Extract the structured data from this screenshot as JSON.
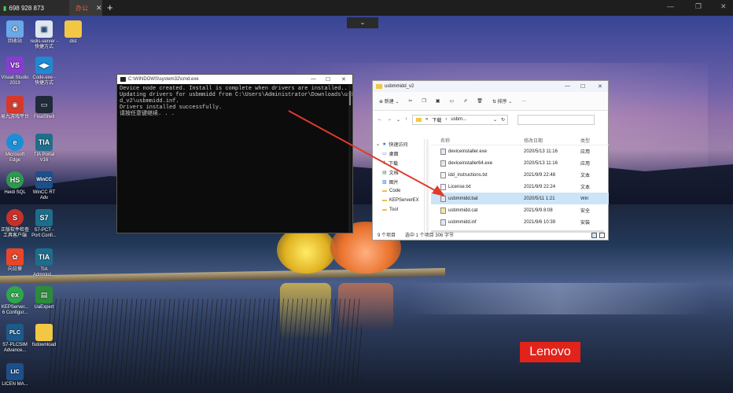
{
  "remote_bar": {
    "tab1_title": "698 928 873",
    "tab2_title": "办公",
    "tab2_close": "✕",
    "new_tab": "+",
    "dropdown": "⌄",
    "min": "—",
    "restore": "❐",
    "close": "✕"
  },
  "desktop_icons": [
    {
      "label": "回收站",
      "color": "#6aa8e8",
      "glyph": "♻"
    },
    {
      "label": "redis-server - 快捷方式",
      "color": "#dfe6f0",
      "glyph": "▣"
    },
    {
      "label": "dist",
      "color": "#f2c744",
      "glyph": ""
    },
    {
      "label": "Visual Studio 2019",
      "color": "#8a3bd1",
      "glyph": "VS"
    },
    {
      "label": "Code.exe - 快捷方式",
      "color": "#1f8ad2",
      "glyph": "◀▶"
    },
    {
      "label": "易九游戏平台",
      "color": "#d8382a",
      "glyph": "◉"
    },
    {
      "label": "FinalShell",
      "color": "#202a3a",
      "glyph": "▭"
    },
    {
      "label": "Microsoft Edge",
      "color": "#1a8fd8",
      "glyph": "e"
    },
    {
      "label": "TIA Portal V16",
      "color": "#1f6f8c",
      "glyph": "TIA"
    },
    {
      "label": "Heidi SQL",
      "color": "#2d9b4d",
      "glyph": "HS"
    },
    {
      "label": "WinCC RT Adv",
      "color": "#1d4f8a",
      "glyph": "WinCC"
    },
    {
      "label": "正版软件检查工具客户端",
      "color": "#c8302a",
      "glyph": "S"
    },
    {
      "label": "S7-PCT - Port Confi...",
      "color": "#1d6e8c",
      "glyph": "S7"
    },
    {
      "label": "向日葵",
      "color": "#e8462a",
      "glyph": "✿"
    },
    {
      "label": "TIA Administ...",
      "color": "#1d6e8c",
      "glyph": "TIA"
    },
    {
      "label": "KEPServer... 6 Configur...",
      "color": "#2ea84a",
      "glyph": "ex"
    },
    {
      "label": "UaExpert",
      "color": "#2c8c3a",
      "glyph": "▤"
    },
    {
      "label": "S7-PLCSIM Advance...",
      "color": "#1d5a8c",
      "glyph": "PLC"
    },
    {
      "label": "fsdownload",
      "color": "#f2c744",
      "glyph": ""
    },
    {
      "label": "LICEN MA...",
      "color": "#1d4f8a",
      "glyph": "LIC"
    }
  ],
  "cmd": {
    "title": "C:\\WINDOWS\\system32\\cmd.exe",
    "lines": [
      "Device node created. Install is complete when drivers are installed...",
      "Updating drivers for usbmmidd from C:\\Users\\Administrator\\Downloads\\usbmmid",
      "d_v2\\usbmmidd.inf.",
      "Drivers installed successfully.",
      "请按任意键继续. . ."
    ]
  },
  "explorer": {
    "title": "usbmmidd_v2",
    "new_label": "新建",
    "sort_label": "排序",
    "more": "···",
    "breadcrumb_root": "下载",
    "breadcrumb_folder": "usbm...",
    "nav": [
      {
        "label": "快速访问",
        "glyph": "★"
      },
      {
        "label": "桌面",
        "glyph": "▭"
      },
      {
        "label": "下载",
        "glyph": "⬇"
      },
      {
        "label": "文档",
        "glyph": "▤"
      },
      {
        "label": "图片",
        "glyph": "▨"
      },
      {
        "label": "Code",
        "glyph": "▬"
      },
      {
        "label": "KEPServerEX",
        "glyph": "▬"
      },
      {
        "label": "Tool",
        "glyph": "▬"
      }
    ],
    "columns": {
      "name": "名称",
      "date": "修改日期",
      "type": "类型"
    },
    "files": [
      {
        "name": "deviceinstaller.exe",
        "date": "2020/5/13 11:16",
        "type": "应用"
      },
      {
        "name": "deviceinstaller64.exe",
        "date": "2020/5/13 11:16",
        "type": "应用"
      },
      {
        "name": "idd_instructions.txt",
        "date": "2021/9/9 22:48",
        "type": "文本"
      },
      {
        "name": "License.txt",
        "date": "2021/9/9 22:24",
        "type": "文本"
      },
      {
        "name": "usbmmidd.bat",
        "date": "2020/5/11 1:21",
        "type": "Win"
      },
      {
        "name": "usbmmidd.cat",
        "date": "2021/9/9 8:08",
        "type": "安全"
      },
      {
        "name": "usbmmidd.inf",
        "date": "2021/9/6 10:39",
        "type": "安装"
      }
    ],
    "status_count": "9 个项目",
    "status_selected": "选中 1 个项目  306 字节"
  },
  "brand": "Lenovo",
  "colors": {
    "accent_red": "#e2231a",
    "selection": "#cce4f7",
    "arrow": "#e03a2c"
  }
}
